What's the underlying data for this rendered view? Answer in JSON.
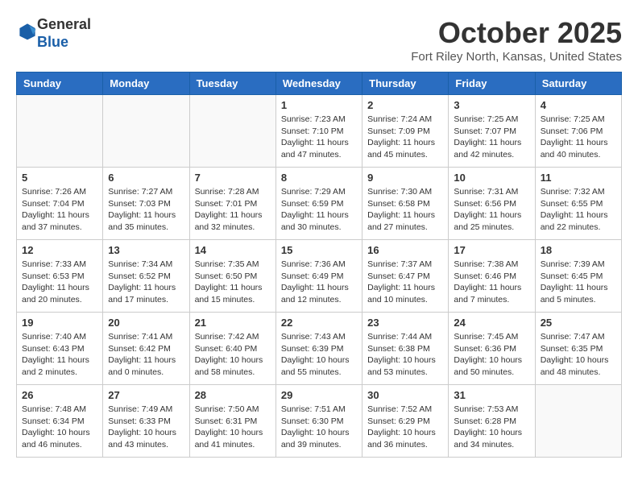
{
  "header": {
    "logo": {
      "line1": "General",
      "line2": "Blue"
    },
    "title": "October 2025",
    "location": "Fort Riley North, Kansas, United States"
  },
  "weekdays": [
    "Sunday",
    "Monday",
    "Tuesday",
    "Wednesday",
    "Thursday",
    "Friday",
    "Saturday"
  ],
  "weeks": [
    [
      {
        "day": "",
        "info": ""
      },
      {
        "day": "",
        "info": ""
      },
      {
        "day": "",
        "info": ""
      },
      {
        "day": "1",
        "info": "Sunrise: 7:23 AM\nSunset: 7:10 PM\nDaylight: 11 hours\nand 47 minutes."
      },
      {
        "day": "2",
        "info": "Sunrise: 7:24 AM\nSunset: 7:09 PM\nDaylight: 11 hours\nand 45 minutes."
      },
      {
        "day": "3",
        "info": "Sunrise: 7:25 AM\nSunset: 7:07 PM\nDaylight: 11 hours\nand 42 minutes."
      },
      {
        "day": "4",
        "info": "Sunrise: 7:25 AM\nSunset: 7:06 PM\nDaylight: 11 hours\nand 40 minutes."
      }
    ],
    [
      {
        "day": "5",
        "info": "Sunrise: 7:26 AM\nSunset: 7:04 PM\nDaylight: 11 hours\nand 37 minutes."
      },
      {
        "day": "6",
        "info": "Sunrise: 7:27 AM\nSunset: 7:03 PM\nDaylight: 11 hours\nand 35 minutes."
      },
      {
        "day": "7",
        "info": "Sunrise: 7:28 AM\nSunset: 7:01 PM\nDaylight: 11 hours\nand 32 minutes."
      },
      {
        "day": "8",
        "info": "Sunrise: 7:29 AM\nSunset: 6:59 PM\nDaylight: 11 hours\nand 30 minutes."
      },
      {
        "day": "9",
        "info": "Sunrise: 7:30 AM\nSunset: 6:58 PM\nDaylight: 11 hours\nand 27 minutes."
      },
      {
        "day": "10",
        "info": "Sunrise: 7:31 AM\nSunset: 6:56 PM\nDaylight: 11 hours\nand 25 minutes."
      },
      {
        "day": "11",
        "info": "Sunrise: 7:32 AM\nSunset: 6:55 PM\nDaylight: 11 hours\nand 22 minutes."
      }
    ],
    [
      {
        "day": "12",
        "info": "Sunrise: 7:33 AM\nSunset: 6:53 PM\nDaylight: 11 hours\nand 20 minutes."
      },
      {
        "day": "13",
        "info": "Sunrise: 7:34 AM\nSunset: 6:52 PM\nDaylight: 11 hours\nand 17 minutes."
      },
      {
        "day": "14",
        "info": "Sunrise: 7:35 AM\nSunset: 6:50 PM\nDaylight: 11 hours\nand 15 minutes."
      },
      {
        "day": "15",
        "info": "Sunrise: 7:36 AM\nSunset: 6:49 PM\nDaylight: 11 hours\nand 12 minutes."
      },
      {
        "day": "16",
        "info": "Sunrise: 7:37 AM\nSunset: 6:47 PM\nDaylight: 11 hours\nand 10 minutes."
      },
      {
        "day": "17",
        "info": "Sunrise: 7:38 AM\nSunset: 6:46 PM\nDaylight: 11 hours\nand 7 minutes."
      },
      {
        "day": "18",
        "info": "Sunrise: 7:39 AM\nSunset: 6:45 PM\nDaylight: 11 hours\nand 5 minutes."
      }
    ],
    [
      {
        "day": "19",
        "info": "Sunrise: 7:40 AM\nSunset: 6:43 PM\nDaylight: 11 hours\nand 2 minutes."
      },
      {
        "day": "20",
        "info": "Sunrise: 7:41 AM\nSunset: 6:42 PM\nDaylight: 11 hours\nand 0 minutes."
      },
      {
        "day": "21",
        "info": "Sunrise: 7:42 AM\nSunset: 6:40 PM\nDaylight: 10 hours\nand 58 minutes."
      },
      {
        "day": "22",
        "info": "Sunrise: 7:43 AM\nSunset: 6:39 PM\nDaylight: 10 hours\nand 55 minutes."
      },
      {
        "day": "23",
        "info": "Sunrise: 7:44 AM\nSunset: 6:38 PM\nDaylight: 10 hours\nand 53 minutes."
      },
      {
        "day": "24",
        "info": "Sunrise: 7:45 AM\nSunset: 6:36 PM\nDaylight: 10 hours\nand 50 minutes."
      },
      {
        "day": "25",
        "info": "Sunrise: 7:47 AM\nSunset: 6:35 PM\nDaylight: 10 hours\nand 48 minutes."
      }
    ],
    [
      {
        "day": "26",
        "info": "Sunrise: 7:48 AM\nSunset: 6:34 PM\nDaylight: 10 hours\nand 46 minutes."
      },
      {
        "day": "27",
        "info": "Sunrise: 7:49 AM\nSunset: 6:33 PM\nDaylight: 10 hours\nand 43 minutes."
      },
      {
        "day": "28",
        "info": "Sunrise: 7:50 AM\nSunset: 6:31 PM\nDaylight: 10 hours\nand 41 minutes."
      },
      {
        "day": "29",
        "info": "Sunrise: 7:51 AM\nSunset: 6:30 PM\nDaylight: 10 hours\nand 39 minutes."
      },
      {
        "day": "30",
        "info": "Sunrise: 7:52 AM\nSunset: 6:29 PM\nDaylight: 10 hours\nand 36 minutes."
      },
      {
        "day": "31",
        "info": "Sunrise: 7:53 AM\nSunset: 6:28 PM\nDaylight: 10 hours\nand 34 minutes."
      },
      {
        "day": "",
        "info": ""
      }
    ]
  ]
}
